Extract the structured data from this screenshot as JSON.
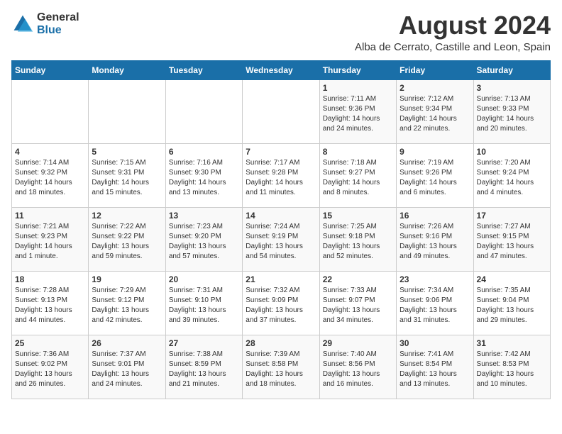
{
  "logo": {
    "line1": "General",
    "line2": "Blue"
  },
  "title": {
    "month_year": "August 2024",
    "location": "Alba de Cerrato, Castille and Leon, Spain"
  },
  "days_of_week": [
    "Sunday",
    "Monday",
    "Tuesday",
    "Wednesday",
    "Thursday",
    "Friday",
    "Saturday"
  ],
  "weeks": [
    {
      "days": [
        {
          "num": "",
          "content": ""
        },
        {
          "num": "",
          "content": ""
        },
        {
          "num": "",
          "content": ""
        },
        {
          "num": "",
          "content": ""
        },
        {
          "num": "1",
          "content": "Sunrise: 7:11 AM\nSunset: 9:36 PM\nDaylight: 14 hours\nand 24 minutes."
        },
        {
          "num": "2",
          "content": "Sunrise: 7:12 AM\nSunset: 9:34 PM\nDaylight: 14 hours\nand 22 minutes."
        },
        {
          "num": "3",
          "content": "Sunrise: 7:13 AM\nSunset: 9:33 PM\nDaylight: 14 hours\nand 20 minutes."
        }
      ]
    },
    {
      "days": [
        {
          "num": "4",
          "content": "Sunrise: 7:14 AM\nSunset: 9:32 PM\nDaylight: 14 hours\nand 18 minutes."
        },
        {
          "num": "5",
          "content": "Sunrise: 7:15 AM\nSunset: 9:31 PM\nDaylight: 14 hours\nand 15 minutes."
        },
        {
          "num": "6",
          "content": "Sunrise: 7:16 AM\nSunset: 9:30 PM\nDaylight: 14 hours\nand 13 minutes."
        },
        {
          "num": "7",
          "content": "Sunrise: 7:17 AM\nSunset: 9:28 PM\nDaylight: 14 hours\nand 11 minutes."
        },
        {
          "num": "8",
          "content": "Sunrise: 7:18 AM\nSunset: 9:27 PM\nDaylight: 14 hours\nand 8 minutes."
        },
        {
          "num": "9",
          "content": "Sunrise: 7:19 AM\nSunset: 9:26 PM\nDaylight: 14 hours\nand 6 minutes."
        },
        {
          "num": "10",
          "content": "Sunrise: 7:20 AM\nSunset: 9:24 PM\nDaylight: 14 hours\nand 4 minutes."
        }
      ]
    },
    {
      "days": [
        {
          "num": "11",
          "content": "Sunrise: 7:21 AM\nSunset: 9:23 PM\nDaylight: 14 hours\nand 1 minute."
        },
        {
          "num": "12",
          "content": "Sunrise: 7:22 AM\nSunset: 9:22 PM\nDaylight: 13 hours\nand 59 minutes."
        },
        {
          "num": "13",
          "content": "Sunrise: 7:23 AM\nSunset: 9:20 PM\nDaylight: 13 hours\nand 57 minutes."
        },
        {
          "num": "14",
          "content": "Sunrise: 7:24 AM\nSunset: 9:19 PM\nDaylight: 13 hours\nand 54 minutes."
        },
        {
          "num": "15",
          "content": "Sunrise: 7:25 AM\nSunset: 9:18 PM\nDaylight: 13 hours\nand 52 minutes."
        },
        {
          "num": "16",
          "content": "Sunrise: 7:26 AM\nSunset: 9:16 PM\nDaylight: 13 hours\nand 49 minutes."
        },
        {
          "num": "17",
          "content": "Sunrise: 7:27 AM\nSunset: 9:15 PM\nDaylight: 13 hours\nand 47 minutes."
        }
      ]
    },
    {
      "days": [
        {
          "num": "18",
          "content": "Sunrise: 7:28 AM\nSunset: 9:13 PM\nDaylight: 13 hours\nand 44 minutes."
        },
        {
          "num": "19",
          "content": "Sunrise: 7:29 AM\nSunset: 9:12 PM\nDaylight: 13 hours\nand 42 minutes."
        },
        {
          "num": "20",
          "content": "Sunrise: 7:31 AM\nSunset: 9:10 PM\nDaylight: 13 hours\nand 39 minutes."
        },
        {
          "num": "21",
          "content": "Sunrise: 7:32 AM\nSunset: 9:09 PM\nDaylight: 13 hours\nand 37 minutes."
        },
        {
          "num": "22",
          "content": "Sunrise: 7:33 AM\nSunset: 9:07 PM\nDaylight: 13 hours\nand 34 minutes."
        },
        {
          "num": "23",
          "content": "Sunrise: 7:34 AM\nSunset: 9:06 PM\nDaylight: 13 hours\nand 31 minutes."
        },
        {
          "num": "24",
          "content": "Sunrise: 7:35 AM\nSunset: 9:04 PM\nDaylight: 13 hours\nand 29 minutes."
        }
      ]
    },
    {
      "days": [
        {
          "num": "25",
          "content": "Sunrise: 7:36 AM\nSunset: 9:02 PM\nDaylight: 13 hours\nand 26 minutes."
        },
        {
          "num": "26",
          "content": "Sunrise: 7:37 AM\nSunset: 9:01 PM\nDaylight: 13 hours\nand 24 minutes."
        },
        {
          "num": "27",
          "content": "Sunrise: 7:38 AM\nSunset: 8:59 PM\nDaylight: 13 hours\nand 21 minutes."
        },
        {
          "num": "28",
          "content": "Sunrise: 7:39 AM\nSunset: 8:58 PM\nDaylight: 13 hours\nand 18 minutes."
        },
        {
          "num": "29",
          "content": "Sunrise: 7:40 AM\nSunset: 8:56 PM\nDaylight: 13 hours\nand 16 minutes."
        },
        {
          "num": "30",
          "content": "Sunrise: 7:41 AM\nSunset: 8:54 PM\nDaylight: 13 hours\nand 13 minutes."
        },
        {
          "num": "31",
          "content": "Sunrise: 7:42 AM\nSunset: 8:53 PM\nDaylight: 13 hours\nand 10 minutes."
        }
      ]
    }
  ]
}
